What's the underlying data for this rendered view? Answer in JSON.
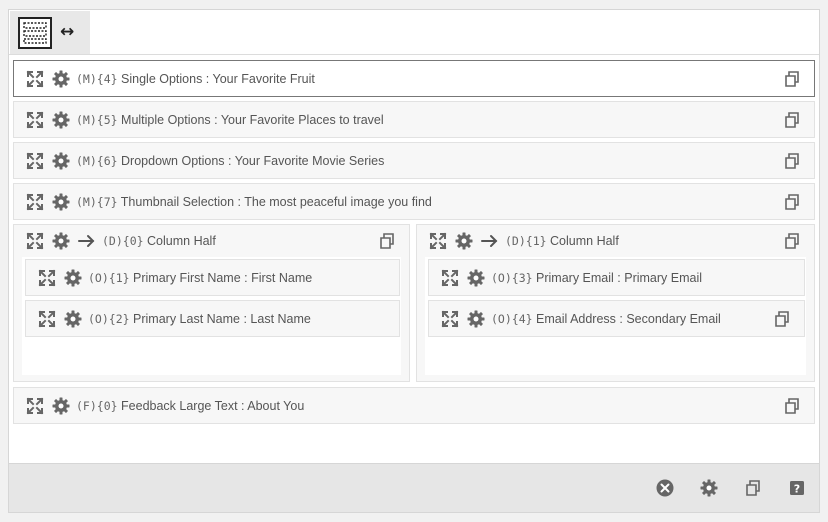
{
  "toolbar": {
    "tab_icon": "form-layout-icon",
    "resize_icon": "horizontal-resize-icon",
    "resize_glyph": "↔"
  },
  "fields": [
    {
      "code": "(M){4}",
      "label": "Single Options : Your Favorite Fruit"
    },
    {
      "code": "(M){5}",
      "label": "Multiple Options : Your Favorite Places to travel"
    },
    {
      "code": "(M){6}",
      "label": "Dropdown Options : Your Favorite Movie Series"
    },
    {
      "code": "(M){7}",
      "label": "Thumbnail Selection : The most peaceful image you find"
    }
  ],
  "columns": [
    {
      "code": "(D){0}",
      "label": "Column Half",
      "fields": [
        {
          "code": "(O){1}",
          "label": "Primary First Name : First Name"
        },
        {
          "code": "(O){2}",
          "label": "Primary Last Name : Last Name"
        }
      ]
    },
    {
      "code": "(D){1}",
      "label": "Column Half",
      "fields": [
        {
          "code": "(O){3}",
          "label": "Primary Email : Primary Email"
        },
        {
          "code": "(O){4}",
          "label": "Email Address : Secondary Email"
        }
      ]
    }
  ],
  "feedback": {
    "code": "(F){0}",
    "label": "Feedback Large Text : About You"
  },
  "footer": {
    "buttons": [
      "close-icon",
      "gear-icon",
      "copy-icon",
      "help-icon"
    ]
  },
  "colors": {
    "icon": "#666666",
    "active_border": "#777777",
    "footer_bg": "#e6e6e6"
  }
}
